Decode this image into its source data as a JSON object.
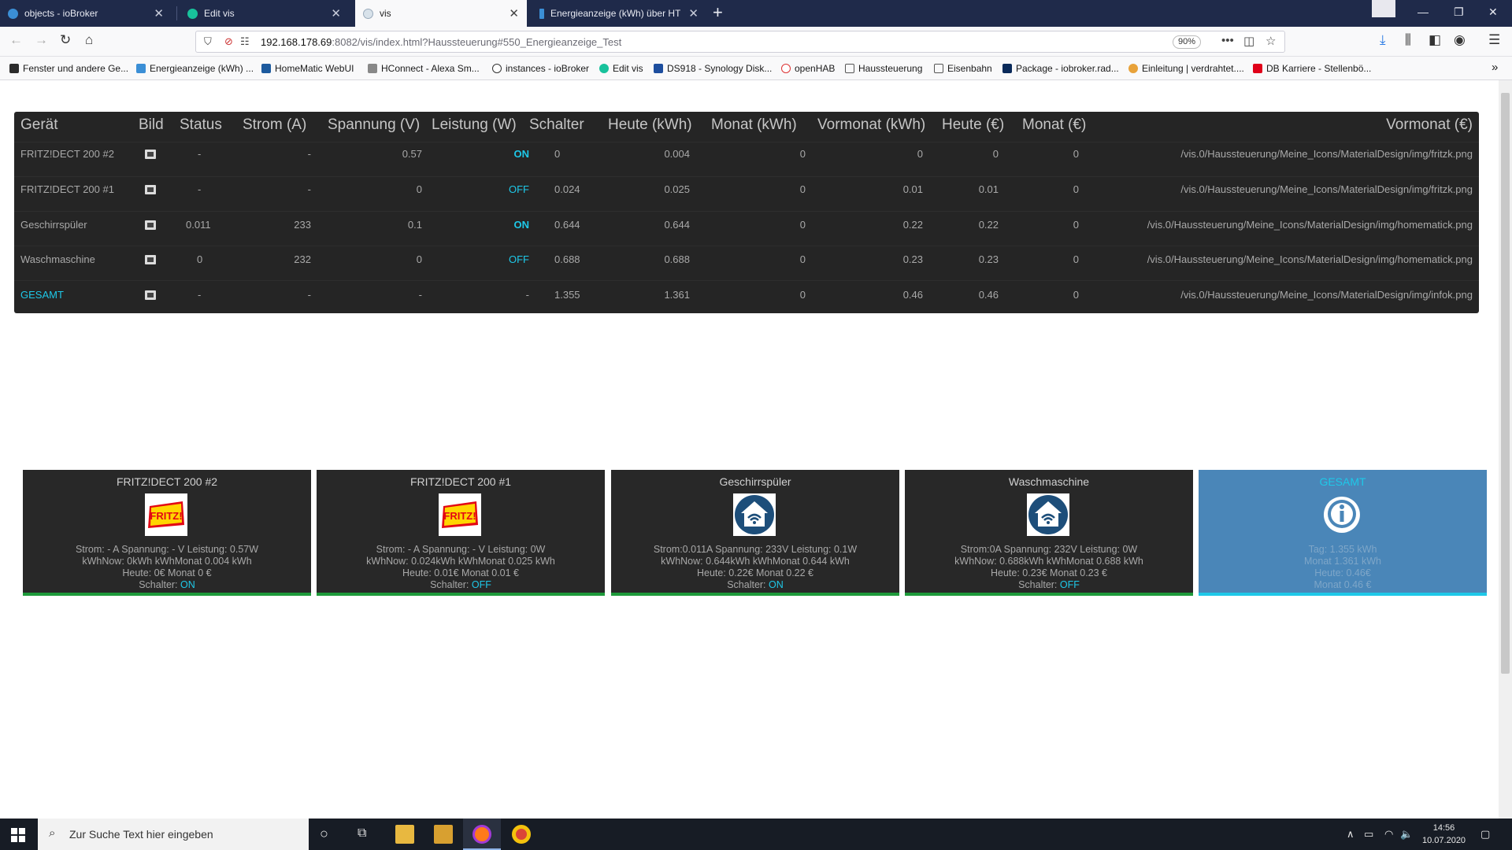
{
  "browser": {
    "tabs": [
      {
        "title": "objects - ioBroker"
      },
      {
        "title": "Edit vis"
      },
      {
        "title": "vis"
      },
      {
        "title": "Energieanzeige (kWh) über HTML..."
      }
    ],
    "url_host": "192.168.178.69",
    "url_rest": ":8082/vis/index.html?Haussteuerung#550_Energieanzeige_Test",
    "zoom": "90%",
    "bookmarks": [
      "Fenster und andere Ge...",
      "Energieanzeige (kWh) ...",
      "HomeMatic WebUI",
      "HConnect - Alexa Sm...",
      "instances - ioBroker",
      "Edit vis",
      "DS918 - Synology Disk...",
      "openHAB",
      "Haussteuerung",
      "Eisenbahn",
      "Package - iobroker.rad...",
      "Einleitung | verdrahtet....",
      "DB Karriere - Stellenbö..."
    ]
  },
  "table": {
    "headers": [
      "Gerät",
      "Bild",
      "Status",
      "Strom (A)",
      "Spannung (V)",
      "Leistung (W)",
      "Schalter",
      "Heute (kWh)",
      "Monat (kWh)",
      "Vormonat (kWh)",
      "Heute (€)",
      "Monat (€)",
      "Vormonat (€)"
    ],
    "rows": [
      {
        "geraet": "FRITZ!DECT 200 #2",
        "status": "-",
        "strom": "-",
        "spannung": "0.57",
        "leistung": "ON",
        "schalter": "0",
        "heute_kwh": "0.004",
        "monat_kwh": "0",
        "vormonat_kwh": "0",
        "heute_eur": "0",
        "monat_eur": "0",
        "vormonat_eur": "/vis.0/Haussteuerung/Meine_Icons/MaterialDesign/img/fritzk.png"
      },
      {
        "geraet": "FRITZ!DECT 200 #1",
        "status": "-",
        "strom": "-",
        "spannung": "0",
        "leistung": "OFF",
        "schalter": "0.024",
        "heute_kwh": "0.025",
        "monat_kwh": "0",
        "vormonat_kwh": "0.01",
        "heute_eur": "0.01",
        "monat_eur": "0",
        "vormonat_eur": "/vis.0/Haussteuerung/Meine_Icons/MaterialDesign/img/fritzk.png"
      },
      {
        "geraet": "Geschirrspüler",
        "status": "0.011",
        "strom": "233",
        "spannung": "0.1",
        "leistung": "ON",
        "schalter": "0.644",
        "heute_kwh": "0.644",
        "monat_kwh": "0",
        "vormonat_kwh": "0.22",
        "heute_eur": "0.22",
        "monat_eur": "0",
        "vormonat_eur": "/vis.0/Haussteuerung/Meine_Icons/MaterialDesign/img/homematick.png"
      },
      {
        "geraet": "Waschmaschine",
        "status": "0",
        "strom": "232",
        "spannung": "0",
        "leistung": "OFF",
        "schalter": "0.688",
        "heute_kwh": "0.688",
        "monat_kwh": "0",
        "vormonat_kwh": "0.23",
        "heute_eur": "0.23",
        "monat_eur": "0",
        "vormonat_eur": "/vis.0/Haussteuerung/Meine_Icons/MaterialDesign/img/homematick.png"
      },
      {
        "geraet": "GESAMT",
        "status": "-",
        "strom": "-",
        "spannung": "-",
        "leistung": "-",
        "schalter": "1.355",
        "heute_kwh": "1.361",
        "monat_kwh": "0",
        "vormonat_kwh": "0.46",
        "heute_eur": "0.46",
        "monat_eur": "0",
        "vormonat_eur": "/vis.0/Haussteuerung/Meine_Icons/MaterialDesign/img/infok.png"
      }
    ]
  },
  "cards": [
    {
      "title": "FRITZ!DECT 200 #2",
      "logo_text": "FRITZ!",
      "line1": "Strom: - A Spannung: - V Leistung: 0.57W",
      "line2": "kWhNow: 0kWh kWhMonat 0.004 kWh",
      "line3": "Heute: 0€ Monat 0 €",
      "switch_label": "Schalter:",
      "switch": "ON"
    },
    {
      "title": "FRITZ!DECT 200 #1",
      "logo_text": "FRITZ!",
      "line1": "Strom: - A Spannung: - V Leistung: 0W",
      "line2": "kWhNow: 0.024kWh kWhMonat 0.025 kWh",
      "line3": "Heute: 0.01€ Monat 0.01 €",
      "switch_label": "Schalter:",
      "switch": "OFF"
    },
    {
      "title": "Geschirrspüler",
      "line1": "Strom:0.011A Spannung: 233V Leistung: 0.1W",
      "line2": "kWhNow: 0.644kWh kWhMonat 0.644 kWh",
      "line3": "Heute: 0.22€ Monat 0.22 €",
      "switch_label": "Schalter:",
      "switch": "ON"
    },
    {
      "title": "Waschmaschine",
      "line1": "Strom:0A Spannung: 232V Leistung: 0W",
      "line2": "kWhNow: 0.688kWh kWhMonat 0.688 kWh",
      "line3": "Heute: 0.23€ Monat 0.23 €",
      "switch_label": "Schalter:",
      "switch": "OFF"
    },
    {
      "title": "GESAMT",
      "line1": "Tag: 1.355 kWh",
      "line2": "Monat 1.361 kWh",
      "line3": "Heute: 0.46€",
      "line4": "Monat 0.46 €"
    }
  ],
  "taskbar": {
    "search_placeholder": "Zur Suche Text hier eingeben",
    "time": "14:56",
    "date": "10.07.2020"
  },
  "colors": {
    "accent": "#1ec8e8",
    "panel": "#252525",
    "total_card": "#4a86b8",
    "tabbar": "#1f2a4a"
  }
}
